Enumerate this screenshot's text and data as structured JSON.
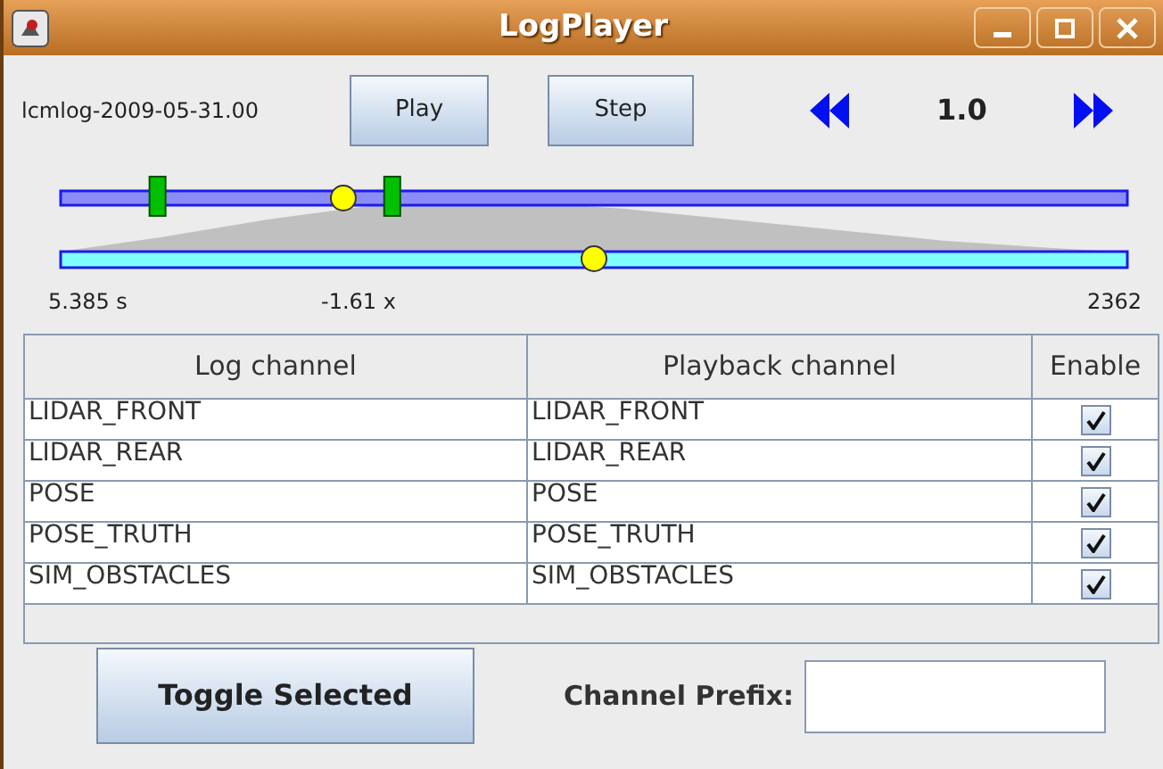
{
  "window": {
    "title": "LogPlayer"
  },
  "toolbar": {
    "log_name": "lcmlog-2009-05-31.00",
    "play_button": "Play",
    "step_button": "Step",
    "speed": "1.0"
  },
  "timeline": {
    "level": 0.265,
    "markers": [
      {
        "level": 0.09
      },
      {
        "level": 0.31
      }
    ]
  },
  "speed_slider": {
    "level": 0.5
  },
  "readouts": {
    "time": "5.385 s",
    "rate": "-1.61 x",
    "count": "2362"
  },
  "table": {
    "columns": [
      "Log channel",
      "Playback channel",
      "Enable"
    ],
    "rows": [
      {
        "log": "LIDAR_FRONT",
        "playback": "LIDAR_FRONT",
        "enabled": true
      },
      {
        "log": "LIDAR_REAR",
        "playback": "LIDAR_REAR",
        "enabled": true
      },
      {
        "log": "POSE",
        "playback": "POSE",
        "enabled": true
      },
      {
        "log": "POSE_TRUTH",
        "playback": "POSE_TRUTH",
        "enabled": true
      },
      {
        "log": "SIM_OBSTACLES",
        "playback": "SIM_OBSTACLES",
        "enabled": true
      }
    ]
  },
  "toggle_button": "Toggle Selected",
  "prefix": {
    "label": "Channel Prefix:"
  }
}
